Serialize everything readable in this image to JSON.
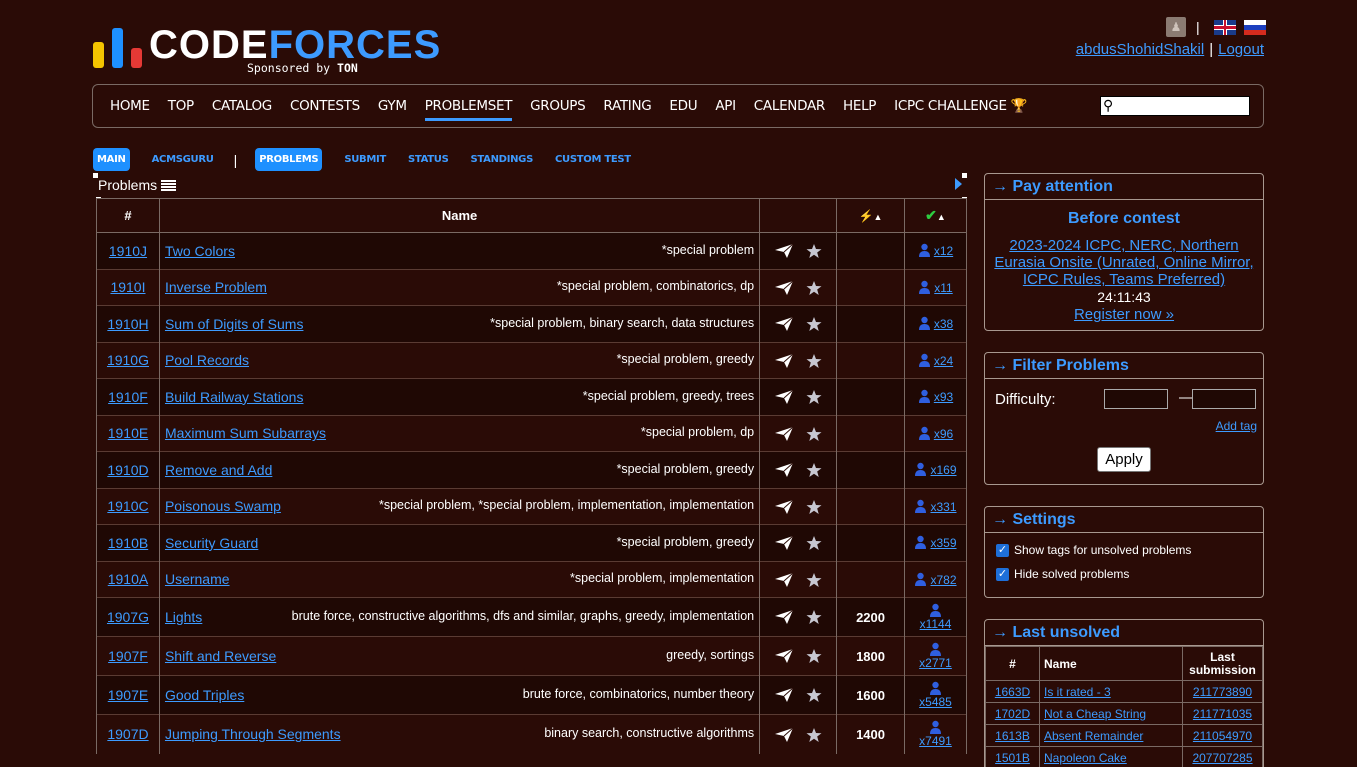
{
  "brand": {
    "word_code": "CODE",
    "word_forces": "FORCES",
    "sponsored_prefix": "Sponsored by",
    "sponsor": "TON"
  },
  "header": {
    "username": "abdusShohidShakil",
    "separator": "|",
    "logout": "Logout"
  },
  "nav": [
    "HOME",
    "TOP",
    "CATALOG",
    "CONTESTS",
    "GYM",
    "PROBLEMSET",
    "GROUPS",
    "RATING",
    "EDU",
    "API",
    "CALENDAR",
    "HELP",
    "ICPC CHALLENGE 🏆"
  ],
  "search": {
    "placeholder": ""
  },
  "submenu": {
    "main": "MAIN",
    "acmsguru": "ACMSGURU",
    "divider": "|",
    "problems": "PROBLEMS",
    "submit": "SUBMIT",
    "status": "STATUS",
    "standings": "STANDINGS",
    "custom_test": "CUSTOM TEST"
  },
  "problems": {
    "title": "Problems",
    "headers": {
      "id": "#",
      "name": "Name"
    },
    "rows": [
      {
        "id": "1910J",
        "name": "Two Colors",
        "tags": "*special problem",
        "rating": "",
        "solved": "x12"
      },
      {
        "id": "1910I",
        "name": "Inverse Problem",
        "tags": "*special problem, combinatorics, dp",
        "rating": "",
        "solved": "x11"
      },
      {
        "id": "1910H",
        "name": "Sum of Digits of Sums",
        "tags": "*special problem, binary search, data structures",
        "rating": "",
        "solved": "x38"
      },
      {
        "id": "1910G",
        "name": "Pool Records",
        "tags": "*special problem, greedy",
        "rating": "",
        "solved": "x24"
      },
      {
        "id": "1910F",
        "name": "Build Railway Stations",
        "tags": "*special problem, greedy, trees",
        "rating": "",
        "solved": "x93"
      },
      {
        "id": "1910E",
        "name": "Maximum Sum Subarrays",
        "tags": "*special problem, dp",
        "rating": "",
        "solved": "x96"
      },
      {
        "id": "1910D",
        "name": "Remove and Add",
        "tags": "*special problem, greedy",
        "rating": "",
        "solved": "x169"
      },
      {
        "id": "1910C",
        "name": "Poisonous Swamp",
        "tags": "*special problem, *special problem, implementation, implementation",
        "rating": "",
        "solved": "x331"
      },
      {
        "id": "1910B",
        "name": "Security Guard",
        "tags": "*special problem, greedy",
        "rating": "",
        "solved": "x359"
      },
      {
        "id": "1910A",
        "name": "Username",
        "tags": "*special problem, implementation",
        "rating": "",
        "solved": "x782"
      },
      {
        "id": "1907G",
        "name": "Lights",
        "tags": "brute force, constructive algorithms, dfs and similar, graphs, greedy, implementation",
        "rating": "2200",
        "solved": "x1144"
      },
      {
        "id": "1907F",
        "name": "Shift and Reverse",
        "tags": "greedy, sortings",
        "rating": "1800",
        "solved": "x2771"
      },
      {
        "id": "1907E",
        "name": "Good Triples",
        "tags": "brute force, combinatorics, number theory",
        "rating": "1600",
        "solved": "x5485"
      },
      {
        "id": "1907D",
        "name": "Jumping Through Segments",
        "tags": "binary search, constructive algorithms",
        "rating": "1400",
        "solved": "x7491"
      }
    ]
  },
  "pay_attention": {
    "title": "→ Pay attention",
    "subtitle": "Before contest",
    "contest": "2023-2024 ICPC, NERC, Northern Eurasia Onsite (Unrated, Online Mirror, ICPC Rules, Teams Preferred)",
    "countdown": "24:11:43",
    "register": "Register now »"
  },
  "filter": {
    "title": "→ Filter Problems",
    "difficulty": "Difficulty:",
    "dash": "—",
    "add_tag": "Add tag",
    "apply": "Apply"
  },
  "settings": {
    "title": "→ Settings",
    "opt1": "Show tags for unsolved problems",
    "opt2": "Hide solved problems"
  },
  "last_unsolved": {
    "title": "→ Last unsolved",
    "headers": {
      "id": "#",
      "name": "Name",
      "last": "Last submission"
    },
    "rows": [
      {
        "id": "1663D",
        "name": "Is it rated - 3",
        "sub": "211773890"
      },
      {
        "id": "1702D",
        "name": "Not a Cheap String",
        "sub": "211771035"
      },
      {
        "id": "1613B",
        "name": "Absent Remainder",
        "sub": "211054970"
      },
      {
        "id": "1501B",
        "name": "Napoleon Cake",
        "sub": "207707285"
      }
    ]
  },
  "colors": {
    "background": "#2a0b06",
    "accent": "#3d9bff",
    "logo_yellow": "#f5c400",
    "logo_blue": "#1e90ff",
    "logo_red": "#e53935"
  }
}
